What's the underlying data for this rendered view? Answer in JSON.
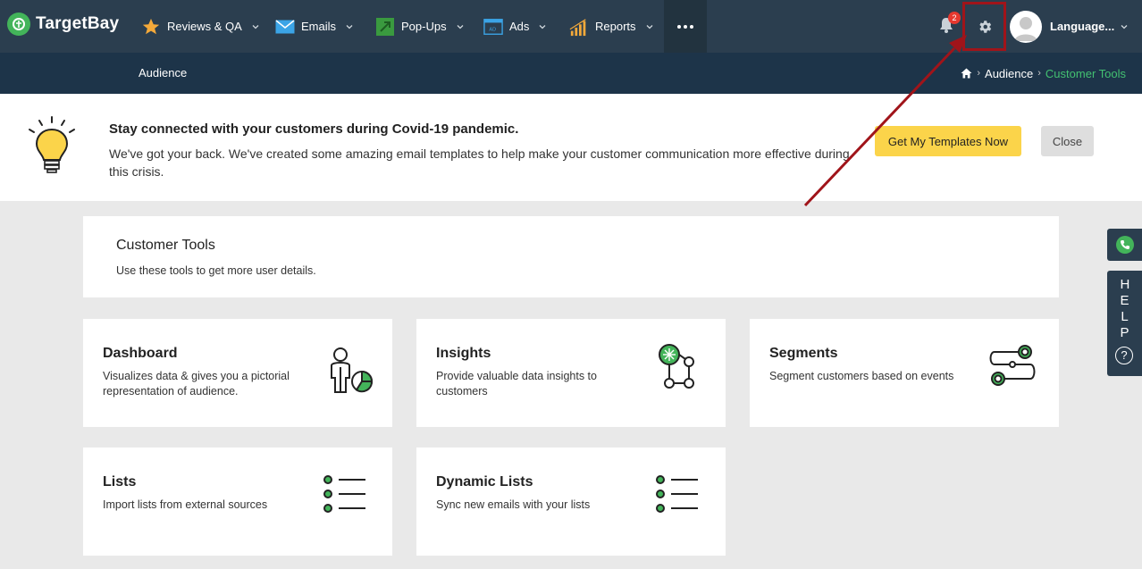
{
  "app": {
    "brand": "TargetBay"
  },
  "nav": {
    "items": [
      {
        "label": "Reviews & QA",
        "icon": "star-icon"
      },
      {
        "label": "Emails",
        "icon": "envelope-icon"
      },
      {
        "label": "Pop-Ups",
        "icon": "popup-arrow-icon"
      },
      {
        "label": "Ads",
        "icon": "ad-screen-icon"
      },
      {
        "label": "Reports",
        "icon": "bar-chart-icon"
      }
    ],
    "notifications_count": "2",
    "language_label": "Language..."
  },
  "subnav": {
    "tab": "Audience",
    "breadcrumb": {
      "parent": "Audience",
      "current": "Customer Tools"
    }
  },
  "banner": {
    "title": "Stay connected with your customers during Covid-19 pandemic.",
    "text": "We've got your back. We've created some amazing email templates to help make your customer communication more effective during this crisis.",
    "primary_button": "Get My Templates Now",
    "close_button": "Close"
  },
  "page": {
    "title": "Customer Tools",
    "subtitle": "Use these tools to get more user details."
  },
  "tools": [
    {
      "title": "Dashboard",
      "desc": "Visualizes data & gives you a pictorial representation of audience."
    },
    {
      "title": "Insights",
      "desc": "Provide valuable data insights to customers"
    },
    {
      "title": "Segments",
      "desc": "Segment customers based on events"
    },
    {
      "title": "Lists",
      "desc": "Import lists from external sources"
    },
    {
      "title": "Dynamic Lists",
      "desc": "Sync new emails with your lists"
    }
  ],
  "help": {
    "label": "HELP",
    "q": "?"
  },
  "colors": {
    "nav_bg": "#2b3e4f",
    "subnav_bg": "#1d3449",
    "accent_green": "#43c171",
    "primary_button": "#fbd44a",
    "annotation_red": "#a0141a"
  }
}
